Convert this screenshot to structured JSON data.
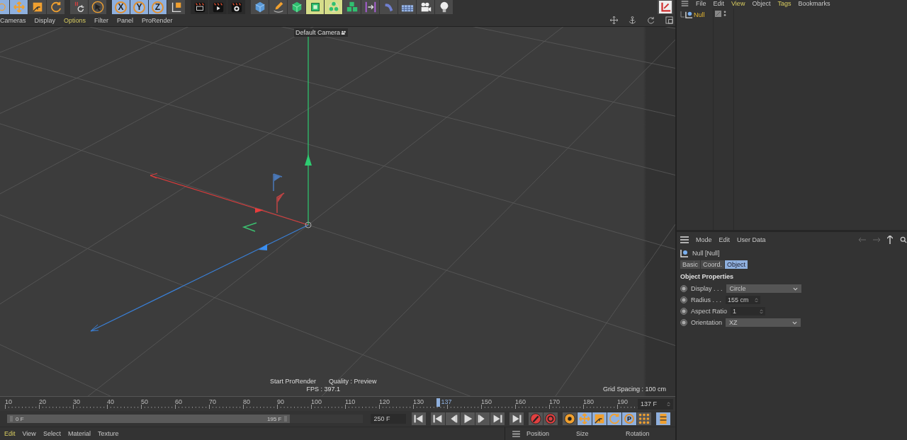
{
  "toolbar": {
    "groups": [
      [
        {
          "on": true
        },
        {
          "on": true
        },
        {
          "on": false
        },
        {
          "on": false
        }
      ],
      [
        {
          "on": false
        },
        {
          "on": false
        }
      ],
      [
        {
          "on": true,
          "label": "X"
        },
        {
          "on": true,
          "label": "Y"
        },
        {
          "on": true,
          "label": "Z"
        },
        {
          "on": false
        }
      ],
      [
        {
          "on": false
        },
        {
          "on": false
        },
        {
          "on": false
        }
      ],
      [
        {
          "on": false
        },
        {
          "on": false
        },
        {
          "on": false
        },
        {
          "on": true
        },
        {
          "on": true
        },
        {
          "on": false
        },
        {
          "on": false
        },
        {
          "on": false
        },
        {
          "on": false
        },
        {
          "on": false
        },
        {
          "on": false
        }
      ]
    ]
  },
  "viewport": {
    "menu": [
      {
        "label": "Cameras",
        "active": false
      },
      {
        "label": "Display",
        "active": false
      },
      {
        "label": "Options",
        "active": true
      },
      {
        "label": "Filter",
        "active": false
      },
      {
        "label": "Panel",
        "active": false
      },
      {
        "label": "ProRender",
        "active": false
      }
    ],
    "camera_label": "Default Camera",
    "status": [
      "Start ProRender",
      "Quality : Preview"
    ],
    "fps": "FPS : 397.1",
    "grid_spacing": "Grid Spacing : 100 cm"
  },
  "timeline": {
    "ruler_labels_before": [
      "10",
      "20",
      "30",
      "40",
      "50",
      "60",
      "70",
      "80",
      "90",
      "100",
      "110",
      "120",
      "130"
    ],
    "ruler_labels_after": [
      "150",
      "160",
      "170",
      "180",
      "190"
    ],
    "playhead": {
      "label": "137",
      "level": 0.684
    },
    "current_frame": "137 F",
    "range": {
      "start": "0 F",
      "end": "195 F",
      "level": 0.795
    },
    "max_frame": "250 F",
    "transport": [
      [
        {
          "on": false
        }
      ],
      [
        {
          "on": false
        },
        {
          "on": false
        },
        {
          "on": false
        },
        {
          "on": false
        },
        {
          "on": false
        }
      ],
      [
        {
          "on": false
        }
      ],
      [
        {
          "on": false
        },
        {
          "on": false
        }
      ],
      [
        {
          "on": false
        },
        {
          "on": true
        },
        {
          "on": true
        },
        {
          "on": true
        },
        {
          "on": true,
          "label": "P"
        },
        {
          "on": false
        }
      ],
      [
        {
          "on": true
        }
      ]
    ]
  },
  "material_menu": [
    {
      "label": "Edit",
      "active": true
    },
    {
      "label": "View",
      "active": false
    },
    {
      "label": "Select",
      "active": false
    },
    {
      "label": "Material",
      "active": false
    },
    {
      "label": "Texture",
      "active": false
    }
  ],
  "coordinates_header": [
    "Position",
    "Size",
    "Rotation"
  ],
  "object_manager": {
    "menu": [
      {
        "label": "File",
        "active": false
      },
      {
        "label": "Edit",
        "active": false
      },
      {
        "label": "View",
        "active": true
      },
      {
        "label": "Object",
        "active": false
      },
      {
        "label": "Tags",
        "active": true
      },
      {
        "label": "Bookmarks",
        "active": false
      }
    ],
    "objects": [
      {
        "name": "Null",
        "selected": true
      }
    ]
  },
  "attributes": {
    "menu": [
      "Mode",
      "Edit",
      "User Data"
    ],
    "title": "Null [Null]",
    "tabs": [
      {
        "label": "Basic",
        "selected": false
      },
      {
        "label": "Coord.",
        "selected": false
      },
      {
        "label": "Object",
        "selected": true
      }
    ],
    "section": "Object Properties",
    "properties": [
      {
        "kind": "dropdown",
        "label": "Display . . .",
        "value": "Circle"
      },
      {
        "kind": "spinner",
        "label": "Radius . . .",
        "value": "155 cm"
      },
      {
        "kind": "spinner",
        "label": "Aspect Ratio",
        "value": "1"
      },
      {
        "kind": "dropdown",
        "label": "Orientation",
        "value": "XZ"
      }
    ]
  }
}
